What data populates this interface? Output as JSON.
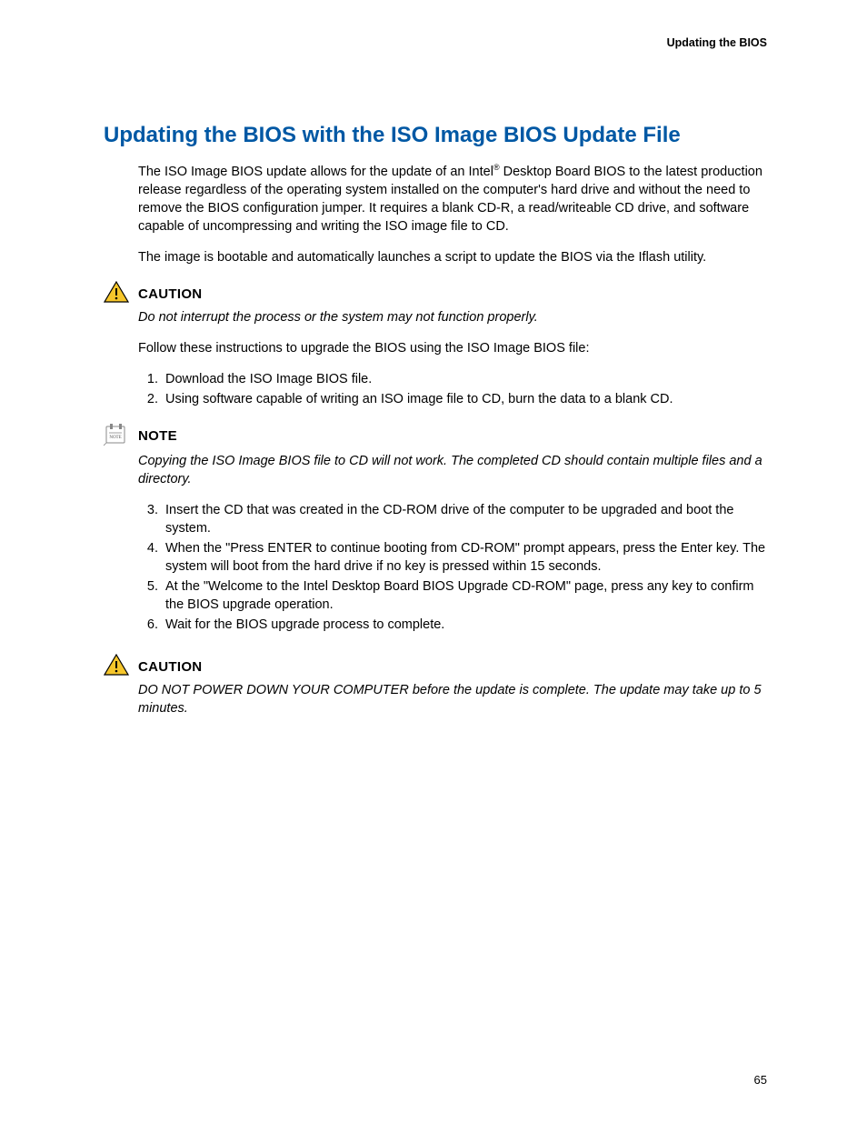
{
  "header": {
    "running_title": "Updating the BIOS"
  },
  "title": "Updating the BIOS with the ISO Image BIOS Update File",
  "paragraphs": {
    "intro1a": "The ISO Image BIOS update allows for the update of an Intel",
    "intro1b": " Desktop Board BIOS to the latest production release regardless of the operating system installed on the computer's hard drive and without the need to remove the BIOS configuration jumper. It requires a blank CD-R, a read/writeable CD drive, and software capable of uncompressing and writing the ISO image file to CD.",
    "reg": "®",
    "intro2": "The image is bootable and automatically launches a script to update the BIOS via the Iflash utility.",
    "follow": "Follow these instructions to upgrade the BIOS using the ISO Image BIOS file:"
  },
  "caution1": {
    "label": "CAUTION",
    "text": "Do not interrupt the process or the system may not function properly."
  },
  "steps_a": {
    "1": "Download the ISO Image BIOS file.",
    "2": "Using software capable of writing an ISO image file to CD, burn the data to a blank CD."
  },
  "note": {
    "label": "NOTE",
    "text": "Copying the ISO Image BIOS file to CD will not work.  The completed CD should contain multiple files and a directory."
  },
  "steps_b": {
    "3": "Insert the CD that was created in the CD-ROM drive of the computer to be upgraded and boot the system.",
    "4": "When the \"Press ENTER to continue booting from CD-ROM\" prompt appears, press the Enter key.  The system will boot from the hard drive if no key is pressed within 15 seconds.",
    "5": "At the \"Welcome to the Intel Desktop Board BIOS Upgrade CD-ROM\" page, press any key to confirm the BIOS upgrade operation.",
    "6": "Wait for the BIOS upgrade process to complete."
  },
  "caution2": {
    "label": "CAUTION",
    "text": "DO NOT POWER DOWN YOUR COMPUTER before the update is complete.  The update may take up to 5 minutes."
  },
  "page_number": "65"
}
